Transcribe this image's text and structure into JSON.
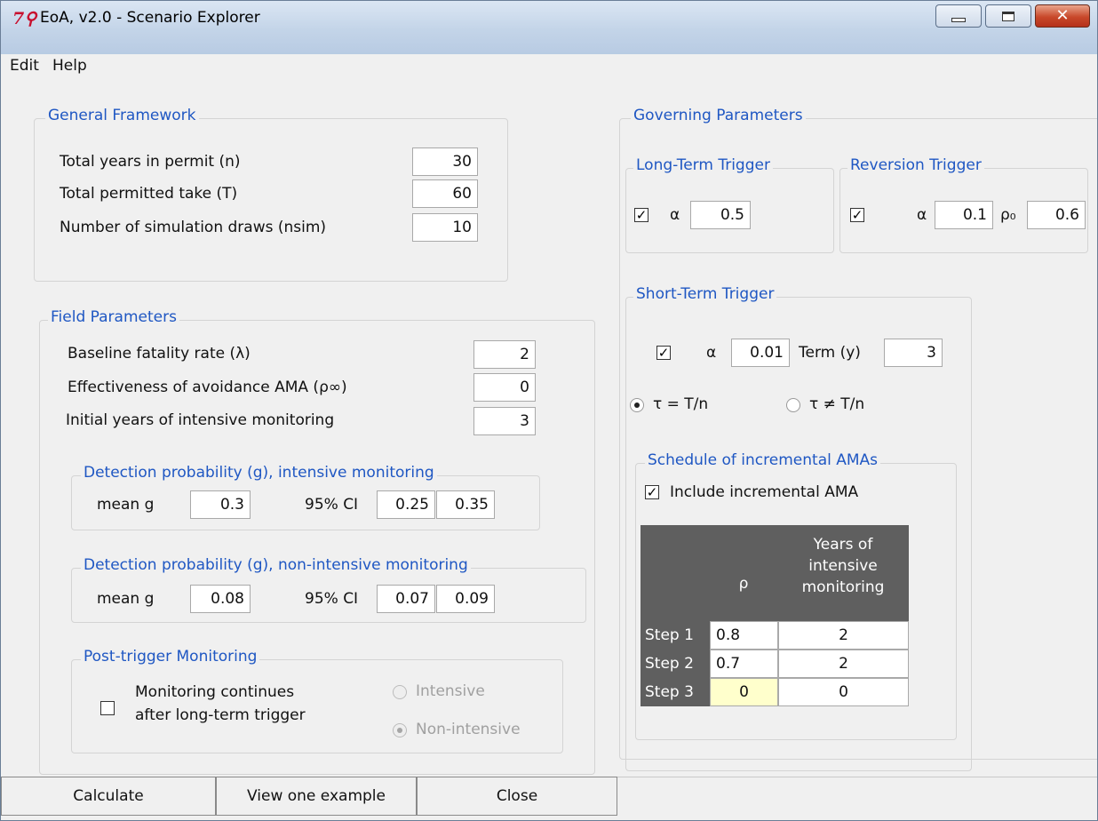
{
  "window": {
    "title": "EoA, v2.0 - Scenario Explorer",
    "app_icon": "tk-feather-icon"
  },
  "menu": [
    "Edit",
    "Help"
  ],
  "general_framework": {
    "title": "General Framework",
    "fields": [
      {
        "label": "Total years in permit (n)",
        "value": "30"
      },
      {
        "label": "Total permitted take (T)",
        "value": "60"
      },
      {
        "label": "Number of simulation draws (nsim)",
        "value": "10"
      }
    ]
  },
  "field_parameters": {
    "title": "Field Parameters",
    "fields": [
      {
        "label": "Baseline fatality rate (λ)",
        "value": "2"
      },
      {
        "label": "Effectiveness of avoidance AMA (ρ∞)",
        "value": "0"
      },
      {
        "label": "Initial years of intensive monitoring",
        "value": "3"
      }
    ],
    "detection_intensive": {
      "title": "Detection probability (g), intensive monitoring",
      "mean_label": "mean g",
      "mean": "0.3",
      "ci_label": "95% CI",
      "ci_low": "0.25",
      "ci_high": "0.35"
    },
    "detection_nonintensive": {
      "title": "Detection probability (g), non-intensive monitoring",
      "mean_label": "mean g",
      "mean": "0.08",
      "ci_label": "95% CI",
      "ci_low": "0.07",
      "ci_high": "0.09"
    },
    "post_trigger": {
      "title": "Post-trigger Monitoring",
      "checkbox_label_1": "Monitoring continues",
      "checkbox_label_2": "after long-term trigger",
      "checked": false,
      "option_intensive": "Intensive",
      "option_nonintensive": "Non-intensive",
      "selected": "Non-intensive"
    }
  },
  "governing": {
    "title": "Governing Parameters",
    "long_term": {
      "title": "Long-Term Trigger",
      "checked": true,
      "alpha_label": "α",
      "alpha": "0.5"
    },
    "reversion": {
      "title": "Reversion Trigger",
      "checked": true,
      "alpha_label": "α",
      "alpha": "0.1",
      "rho_label": "ρ₀",
      "rho": "0.6"
    },
    "short_term": {
      "title": "Short-Term Trigger",
      "checked": true,
      "alpha_label": "α",
      "alpha": "0.01",
      "term_label": "Term (y)",
      "term": "3",
      "tau_equal": "τ = T/n",
      "tau_notequal": "τ ≠ T/n",
      "tau_selected": "τ = T/n"
    },
    "schedule": {
      "title": "Schedule of incremental AMAs",
      "include_label": "Include incremental AMA",
      "include_checked": true,
      "col_rho": "ρ",
      "col_years_1": "Years of",
      "col_years_2": "intensive",
      "col_years_3": "monitoring",
      "rows": [
        {
          "step": "Step 1",
          "rho": "0.8",
          "years": "2"
        },
        {
          "step": "Step 2",
          "rho": "0.7",
          "years": "2"
        },
        {
          "step": "Step 3",
          "rho": "0",
          "years": "0"
        }
      ]
    }
  },
  "buttons": {
    "calculate": "Calculate",
    "view_example": "View one example",
    "close": "Close"
  }
}
